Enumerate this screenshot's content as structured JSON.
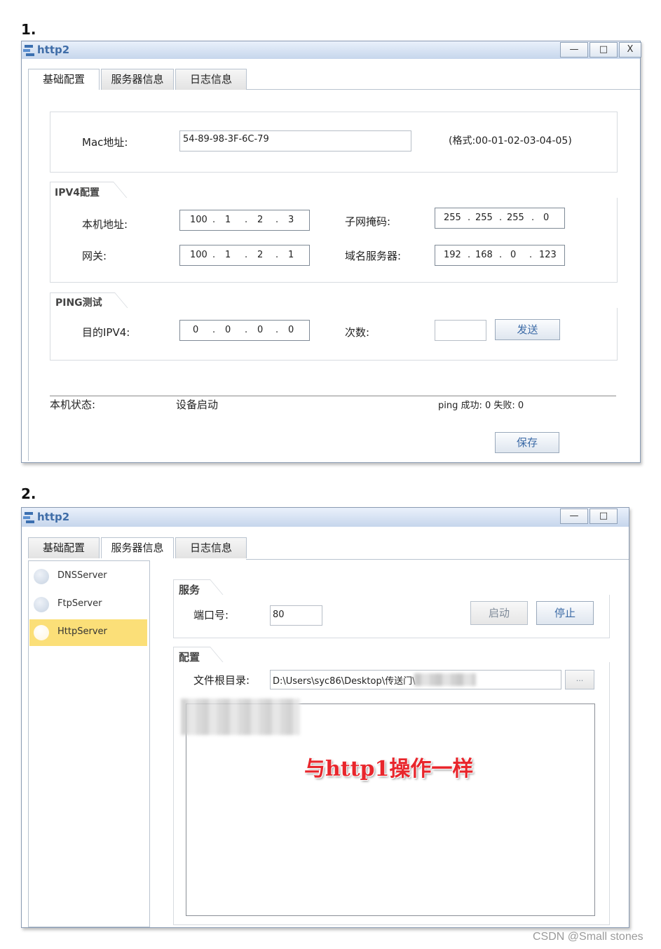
{
  "step1": {
    "label": "1."
  },
  "step2": {
    "label": "2."
  },
  "window1": {
    "title": "http2",
    "buttons": {
      "minimize": "—",
      "maximize": "□",
      "close": "X"
    },
    "tabs": [
      "基础配置",
      "服务器信息",
      "日志信息"
    ],
    "mac": {
      "label": "Mac地址:",
      "value": "54-89-98-3F-6C-79",
      "format_hint": "(格式:00-01-02-03-04-05)"
    },
    "ipv4": {
      "legend": "IPV4配置",
      "host_label": "本机地址:",
      "host_ip": [
        "100",
        "1",
        "2",
        "3"
      ],
      "mask_label": "子网掩码:",
      "mask": [
        "255",
        "255",
        "255",
        "0"
      ],
      "gateway_label": "网关:",
      "gateway": [
        "100",
        "1",
        "2",
        "1"
      ],
      "dns_label": "域名服务器:",
      "dns": [
        "192",
        "168",
        "0",
        "123"
      ]
    },
    "ping": {
      "legend": "PING测试",
      "target_label": "目的IPV4:",
      "target": [
        "0",
        "0",
        "0",
        "0"
      ],
      "count_label": "次数:",
      "count_value": "",
      "send_button": "发送"
    },
    "status": {
      "label": "本机状态:",
      "value": "设备启动",
      "ping_result": "ping 成功: 0 失败: 0"
    },
    "save_button": "保存"
  },
  "window2": {
    "title": "http2",
    "buttons": {
      "minimize": "—",
      "maximize": "□"
    },
    "tabs": [
      "基础配置",
      "服务器信息",
      "日志信息"
    ],
    "server_list": [
      {
        "label": "DNSServer",
        "selected": false
      },
      {
        "label": "FtpServer",
        "selected": false
      },
      {
        "label": "HttpServer",
        "selected": true
      }
    ],
    "service": {
      "legend": "服务",
      "port_label": "端口号:",
      "port_value": "80",
      "start_button": "启动",
      "stop_button": "停止"
    },
    "config": {
      "legend": "配置",
      "root_label": "文件根目录:",
      "root_value": "D:\\Users\\syc86\\Desktop\\传送门\\",
      "browse_button": "..."
    },
    "overlay_note": "与http1操作一样"
  },
  "credit": "CSDN @Small stones"
}
